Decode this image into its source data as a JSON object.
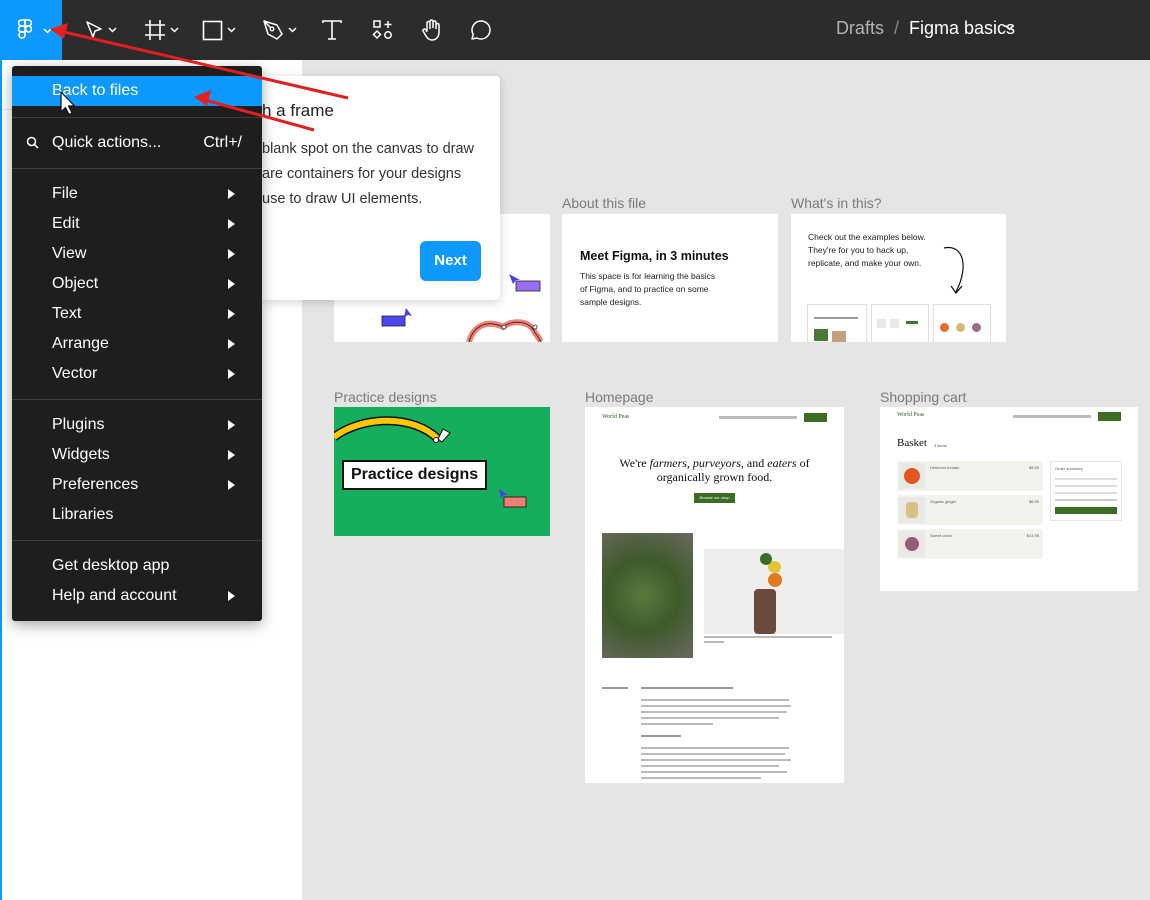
{
  "toolbar": {
    "breadcrumb_parent": "Drafts",
    "breadcrumb_sep": "/",
    "file_name": "Figma basics",
    "icons": [
      "figma-logo-icon",
      "move-tool-icon",
      "frame-tool-icon",
      "shape-tool-icon",
      "pen-tool-icon",
      "text-tool-icon",
      "resources-icon",
      "hand-tool-icon",
      "comment-icon"
    ]
  },
  "menu": {
    "back_to_files": "Back to files",
    "quick_actions": "Quick actions...",
    "quick_actions_shortcut": "Ctrl+/",
    "file": "File",
    "edit": "Edit",
    "view": "View",
    "object": "Object",
    "text": "Text",
    "arrange": "Arrange",
    "vector": "Vector",
    "plugins": "Plugins",
    "widgets": "Widgets",
    "preferences": "Preferences",
    "libraries": "Libraries",
    "get_desktop_app": "Get desktop app",
    "help_and_account": "Help and account"
  },
  "tooltip": {
    "title": "h a frame",
    "line1": "blank spot on the canvas to draw",
    "line2": "are containers for your designs",
    "line3": "use to draw UI elements.",
    "next": "Next"
  },
  "frames": {
    "about_label": "About this file",
    "about_heading": "Meet Figma, in 3 minutes",
    "about_line1": "This space is for learning the basics",
    "about_line2": "of Figma, and to practice on some",
    "about_line3": "sample designs.",
    "whats_label": "What's in this?",
    "whats_line1": "Check out the examples below.",
    "whats_line2": "They're for you to hack up,",
    "whats_line3": "replicate, and make your own.",
    "practice_label": "Practice designs",
    "practice_text": "Practice designs",
    "homepage_label": "Homepage",
    "home_brand": "World Peas",
    "home_headline1a": "We're ",
    "home_headline1b": "farmers, purveyors,",
    "home_headline1c": " and ",
    "home_headline1d": "eaters",
    "home_headline1e": " of",
    "home_headline2": "organically grown food.",
    "home_button": "Browse our shop",
    "cart_label": "Shopping cart",
    "cart_brand": "World Peas",
    "cart_title": "Basket",
    "cart_count": "3 items",
    "cart_item1": "Heirloom tomato",
    "cart_item1_price": "$5.99",
    "cart_item2": "Organic ginger",
    "cart_item2_price": "$6.99",
    "cart_item3": "Sweet onion",
    "cart_item3_price": "$14.95",
    "order_summary": "Order summary"
  }
}
